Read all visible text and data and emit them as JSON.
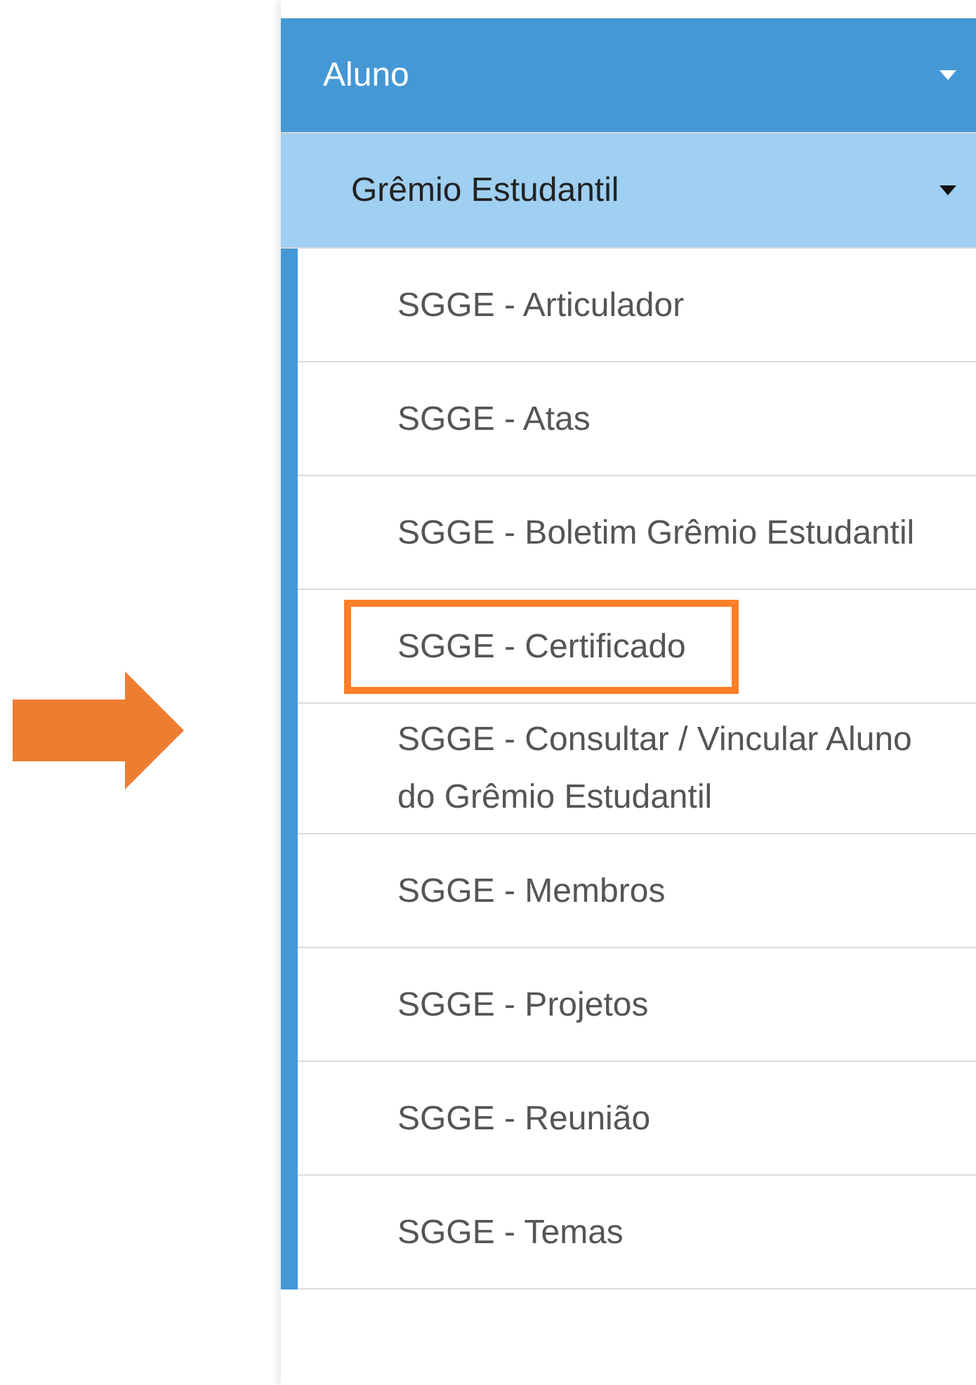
{
  "menu": {
    "header": {
      "label": "Aluno",
      "expanded": true
    },
    "submenu": {
      "label": "Grêmio Estudantil",
      "expanded": true
    },
    "items": [
      {
        "label": "SGGE - Articulador",
        "highlighted": false
      },
      {
        "label": "SGGE - Atas",
        "highlighted": false
      },
      {
        "label": "SGGE - Boletim Grêmio Estudantil",
        "highlighted": false
      },
      {
        "label": "SGGE - Certificado",
        "highlighted": true
      },
      {
        "label": "SGGE - Consultar / Vincular Aluno do Grêmio Estudantil",
        "highlighted": false
      },
      {
        "label": "SGGE - Membros",
        "highlighted": false
      },
      {
        "label": "SGGE - Projetos",
        "highlighted": false
      },
      {
        "label": "SGGE - Reunião",
        "highlighted": false
      },
      {
        "label": "SGGE - Temas",
        "highlighted": false
      }
    ]
  }
}
